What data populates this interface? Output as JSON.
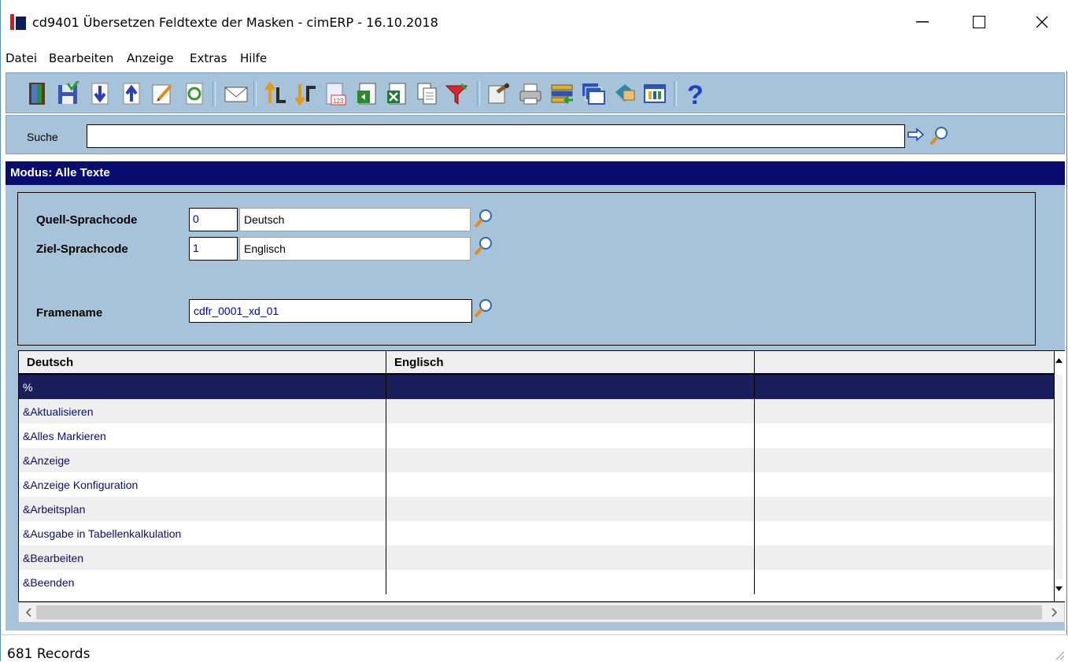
{
  "window": {
    "title": "cd9401 Übersetzen Feldtexte der Masken - cimERP - 16.10.2018",
    "minimize_glyph": "—",
    "maximize_glyph": "☐",
    "close_glyph": "✕"
  },
  "menu": [
    "Datei",
    "Bearbeiten",
    "Anzeige",
    "Extras",
    "Hilfe"
  ],
  "toolbar": {
    "icons": [
      "exit-door-icon",
      "save-icon",
      "record-down-icon",
      "record-up-icon",
      "edit-icon",
      "refresh-icon",
      "mail-icon",
      "sort-ascending-icon",
      "sort-descending-icon",
      "number-format-icon",
      "export-icon",
      "excel-icon",
      "copy-icon",
      "filter-icon",
      "properties-icon",
      "print-icon",
      "transfer-icon",
      "windows-icon",
      "tag-icon",
      "grid-layout-icon",
      "help-icon"
    ]
  },
  "search": {
    "label": "Suche",
    "value": ""
  },
  "mode": {
    "title": "Modus: Alle Texte"
  },
  "form": {
    "source_label": "Quell-Sprachcode",
    "source_code": "0",
    "source_name": "Deutsch",
    "target_label": "Ziel-Sprachcode",
    "target_code": "1",
    "target_name": "Englisch",
    "frame_label": "Framename",
    "frame_value": "cdfr_0001_xd_01"
  },
  "grid": {
    "columns": [
      "Deutsch",
      "Englisch",
      ""
    ],
    "rows": [
      [
        "%",
        "",
        ""
      ],
      [
        "&Aktualisieren",
        "",
        ""
      ],
      [
        "&Alles Markieren",
        "",
        ""
      ],
      [
        "&Anzeige",
        "",
        ""
      ],
      [
        "&Anzeige Konfiguration",
        "",
        ""
      ],
      [
        "&Arbeitsplan",
        "",
        ""
      ],
      [
        "&Ausgabe in Tabellenkalkulation",
        "",
        ""
      ],
      [
        "&Bearbeiten",
        "",
        ""
      ],
      [
        "&Beenden",
        "",
        ""
      ]
    ],
    "selected_row": 0
  },
  "status": {
    "records": "681 Records"
  },
  "colors": {
    "panel": "#a7c3d9",
    "header": "#0a0c70",
    "selected": "#1a1f5c",
    "row_alt": "#efefef"
  }
}
